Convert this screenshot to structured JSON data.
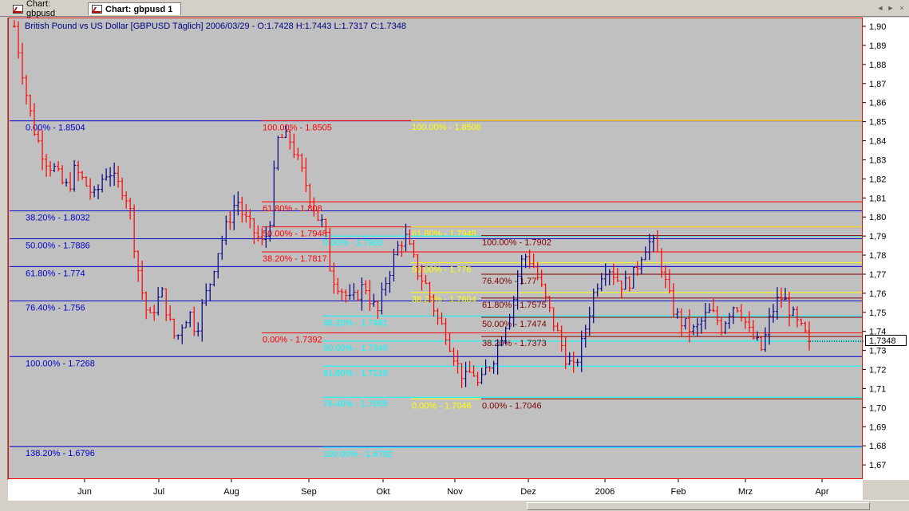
{
  "tabs": [
    {
      "label": "Chart: gbpusd",
      "active": false
    },
    {
      "label": "Chart: gbpusd 1",
      "active": true
    }
  ],
  "nav": [
    "◄",
    "►",
    "×"
  ],
  "chart_info": "British Pound vs US Dollar [GBPUSD  Täglich] 2006/03/29 - O:1.7428 H:1.7443 L:1.7317 C:1.7348",
  "current_price": "1,7348",
  "chart_data": {
    "type": "ohlc",
    "title": "British Pound vs US Dollar [GBPUSD  Täglich] 2006/03/29 - O:1.7428 H:1.7443 L:1.7317 C:1.7348",
    "ylim": [
      1.66,
      1.905
    ],
    "y_ticks": [
      "1,90",
      "1,89",
      "1,88",
      "1,87",
      "1,86",
      "1,85",
      "1,84",
      "1,83",
      "1,82",
      "1,81",
      "1,80",
      "1,79",
      "1,78",
      "1,77",
      "1,76",
      "1,75",
      "1,74",
      "1,73",
      "1,72",
      "1,71",
      "1,70",
      "1,69",
      "1,68",
      "1,67"
    ],
    "x_ticks": [
      "Jun",
      "Jul",
      "Aug",
      "Sep",
      "Okt",
      "Nov",
      "Dez",
      "2006",
      "Feb",
      "Mrz",
      "Apr"
    ],
    "price_path": [
      1.9,
      1.88,
      1.86,
      1.845,
      1.835,
      1.828,
      1.825,
      1.818,
      1.815,
      1.825,
      1.82,
      1.815,
      1.81,
      1.82,
      1.825,
      1.818,
      1.815,
      1.808,
      1.78,
      1.76,
      1.745,
      1.755,
      1.76,
      1.745,
      1.735,
      1.745,
      1.75,
      1.74,
      1.755,
      1.765,
      1.78,
      1.79,
      1.8,
      1.81,
      1.8,
      1.795,
      1.79,
      1.785,
      1.8,
      1.84,
      1.842,
      1.84,
      1.83,
      1.82,
      1.81,
      1.8,
      1.795,
      1.77,
      1.765,
      1.76,
      1.755,
      1.76,
      1.765,
      1.755,
      1.75,
      1.765,
      1.775,
      1.785,
      1.79,
      1.78,
      1.77,
      1.765,
      1.755,
      1.745,
      1.74,
      1.73,
      1.72,
      1.715,
      1.72,
      1.71,
      1.72,
      1.725,
      1.735,
      1.745,
      1.755,
      1.775,
      1.78,
      1.775,
      1.765,
      1.755,
      1.745,
      1.735,
      1.725,
      1.72,
      1.73,
      1.745,
      1.76,
      1.77,
      1.775,
      1.77,
      1.765,
      1.765,
      1.77,
      1.78,
      1.787,
      1.785,
      1.775,
      1.76,
      1.75,
      1.745,
      1.742,
      1.74,
      1.745,
      1.75,
      1.748,
      1.742,
      1.75,
      1.755,
      1.75,
      1.74,
      1.735,
      1.73,
      1.745,
      1.755,
      1.758,
      1.752,
      1.745,
      1.74,
      1.7348
    ],
    "fib_sets": [
      {
        "color": "#0000cc",
        "levels": [
          {
            "label": "0.00% - 1.8504",
            "value": 1.8504
          },
          {
            "label": "38.20% - 1.8032",
            "value": 1.8032
          },
          {
            "label": "50.00% - 1.7886",
            "value": 1.7886
          },
          {
            "label": "61.80% - 1.774",
            "value": 1.774
          },
          {
            "label": "76.40% - 1.756",
            "value": 1.756
          },
          {
            "label": "100.00% - 1.7268",
            "value": 1.7268
          },
          {
            "label": "138.20% - 1.6796",
            "value": 1.6796
          }
        ]
      },
      {
        "color": "#ff0000",
        "levels": [
          {
            "label": "100.00% - 1.8505",
            "value": 1.8505
          },
          {
            "label": "61.80% - 1.808",
            "value": 1.808
          },
          {
            "label": "50.00% - 1.7948",
            "value": 1.7948
          },
          {
            "label": "38.20% - 1.7817",
            "value": 1.7817
          },
          {
            "label": "0.00% - 1.7392",
            "value": 1.7392
          }
        ]
      },
      {
        "color": "#ffff00",
        "levels": [
          {
            "label": "100.00% - 1.8506",
            "value": 1.8506
          },
          {
            "label": "61.80% - 1.7948",
            "value": 1.7948
          },
          {
            "label": "50.00% - 1.776",
            "value": 1.776
          },
          {
            "label": "38.20% - 1.7604",
            "value": 1.7604
          },
          {
            "label": "0.00% - 1.7046",
            "value": 1.7046
          }
        ]
      },
      {
        "color": "#00ffff",
        "levels": [
          {
            "label": "0.00% - 1.7900",
            "value": 1.79
          },
          {
            "label": "38.20% - 1.7481",
            "value": 1.7481
          },
          {
            "label": "50.00% - 1.7349",
            "value": 1.7349
          },
          {
            "label": "61.80% - 1.7218",
            "value": 1.7218
          },
          {
            "label": "76.40% - 1.7055",
            "value": 1.7055
          },
          {
            "label": "100.00% - 1.6792",
            "value": 1.6792
          }
        ]
      },
      {
        "color": "#800000",
        "levels": [
          {
            "label": "100.00% - 1.7902",
            "value": 1.7902
          },
          {
            "label": "76.40% - 1.77",
            "value": 1.77
          },
          {
            "label": "61.80% - 1.7575",
            "value": 1.7575
          },
          {
            "label": "50.00% - 1.7474",
            "value": 1.7474
          },
          {
            "label": "38.20% - 1.7373",
            "value": 1.7373
          },
          {
            "label": "0.00% - 1.7046",
            "value": 1.7046
          }
        ]
      }
    ]
  }
}
